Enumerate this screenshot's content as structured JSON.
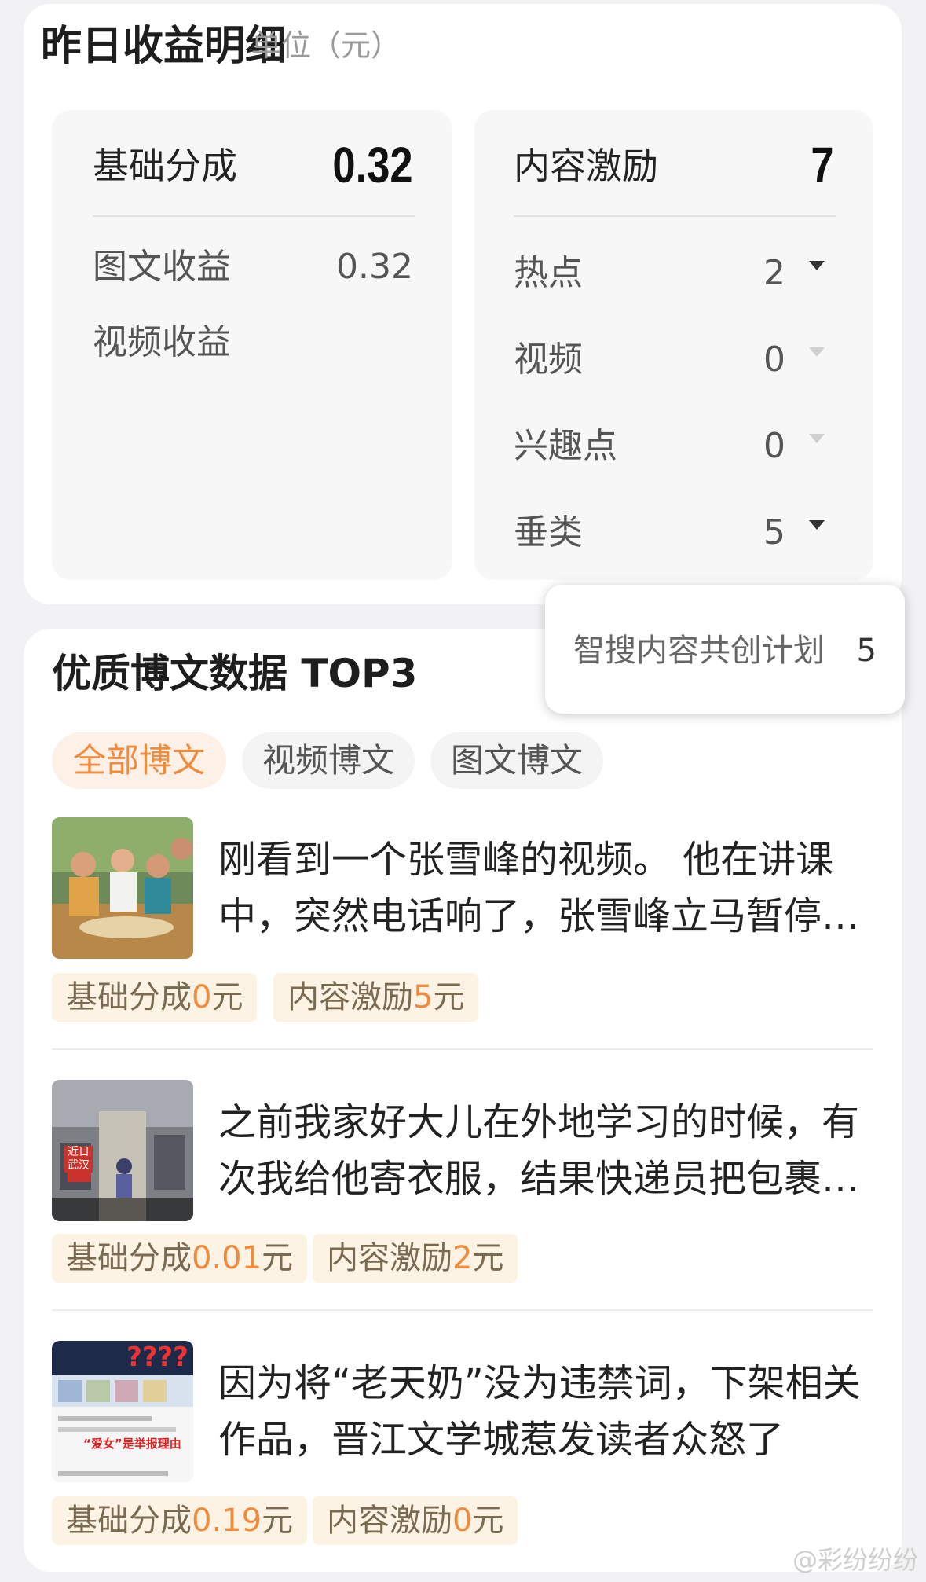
{
  "income": {
    "title": "昨日收益明细",
    "unit": "单位（元）",
    "base": {
      "title": "基础分成",
      "total": "0.32",
      "rows": [
        {
          "label": "图文收益",
          "value": "0.32"
        },
        {
          "label": "视频收益",
          "value": ""
        }
      ]
    },
    "incentive": {
      "title": "内容激励",
      "total": "7",
      "rows": [
        {
          "label": "热点",
          "value": "2",
          "expand_icon": "caret-down-icon"
        },
        {
          "label": "视频",
          "value": "0",
          "expand_icon": "caret-down-icon"
        },
        {
          "label": "兴趣点",
          "value": "0",
          "expand_icon": "caret-down-icon"
        },
        {
          "label": "垂类",
          "value": "5",
          "expand_icon": "caret-down-icon"
        }
      ]
    },
    "popup": {
      "label": "智搜内容共创计划",
      "value": "5"
    }
  },
  "top": {
    "title": "优质博文数据 TOP3",
    "tabs": [
      "全部博文",
      "视频博文",
      "图文博文"
    ],
    "active_tab": 0,
    "posts": [
      {
        "text": "刚看到一个张雪峰的视频。 他在讲课中，突然电话响了，张雪峰立马暂停讲课接了电话",
        "base_label": "基础分成",
        "base_value": "0",
        "base_unit": "元",
        "inc_label": "内容激励",
        "inc_value": "5",
        "inc_unit": "元"
      },
      {
        "text": "之前我家好大儿在外地学习的时候，有次我给他寄衣服，结果快递员把包裹送错了地方",
        "thumb_badge": "近日\n武汉",
        "base_label": "基础分成",
        "base_value": "0.01",
        "base_unit": "元",
        "inc_label": "内容激励",
        "inc_value": "2",
        "inc_unit": "元"
      },
      {
        "text": "因为将“老天奶”没为违禁词，下架相关作品，晋江文学城惹发读者众怒了",
        "thumb_title": "????",
        "thumb_caption": "“爱女”是举报理由",
        "base_label": "基础分成",
        "base_value": "0.19",
        "base_unit": "元",
        "inc_label": "内容激励",
        "inc_value": "0",
        "inc_unit": "元"
      }
    ]
  },
  "watermark": "@彩纷纷纷",
  "colors": {
    "accent": "#f08a3c",
    "tag_bg": "#fdf3e4",
    "tab_active_bg": "#fdf1e7"
  }
}
